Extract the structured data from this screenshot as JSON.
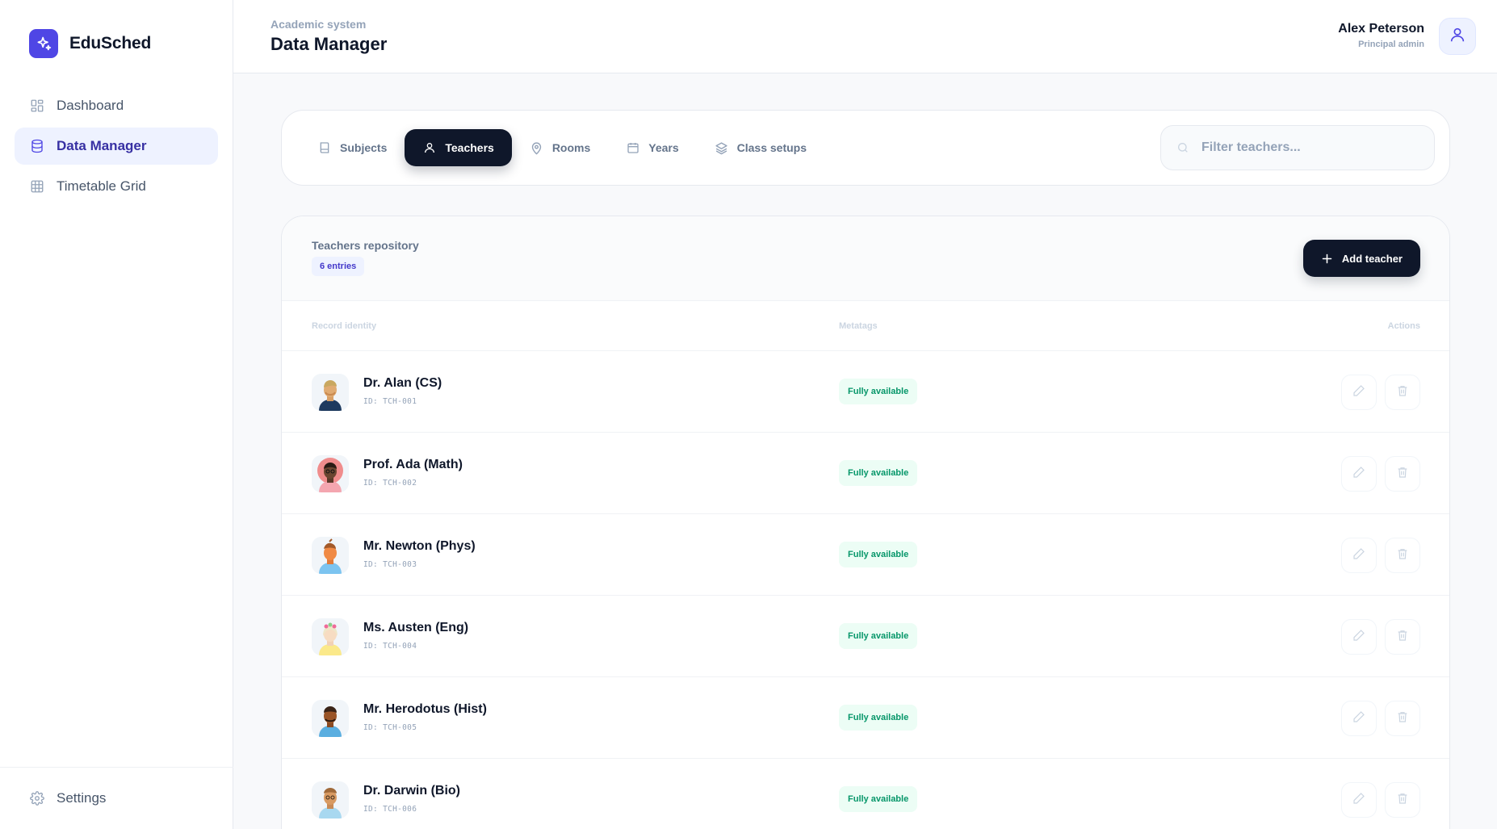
{
  "brand": {
    "name": "EduSched"
  },
  "nav": {
    "items": [
      {
        "label": "Dashboard",
        "icon": "dashboard-grid-icon",
        "active": false
      },
      {
        "label": "Data Manager",
        "icon": "database-icon",
        "active": true
      },
      {
        "label": "Timetable Grid",
        "icon": "table-grid-icon",
        "active": false
      }
    ],
    "settings_label": "Settings"
  },
  "header": {
    "eyebrow": "Academic system",
    "title": "Data Manager",
    "user_name": "Alex Peterson",
    "user_role": "Principal admin"
  },
  "tabs": [
    {
      "label": "Subjects",
      "icon": "book-icon",
      "active": false
    },
    {
      "label": "Teachers",
      "icon": "person-icon",
      "active": true
    },
    {
      "label": "Rooms",
      "icon": "map-pin-icon",
      "active": false
    },
    {
      "label": "Years",
      "icon": "calendar-icon",
      "active": false
    },
    {
      "label": "Class setups",
      "icon": "layers-icon",
      "active": false
    }
  ],
  "search": {
    "placeholder": "Filter teachers..."
  },
  "repository": {
    "title": "Teachers repository",
    "count_label": "6 entries",
    "add_label": "Add teacher",
    "columns": {
      "identity": "Record identity",
      "tags": "Metatags",
      "actions": "Actions"
    },
    "rows": [
      {
        "name": "Dr. Alan (CS)",
        "id": "ID: TCH-001",
        "status": "Fully available"
      },
      {
        "name": "Prof. Ada (Math)",
        "id": "ID: TCH-002",
        "status": "Fully available"
      },
      {
        "name": "Mr. Newton (Phys)",
        "id": "ID: TCH-003",
        "status": "Fully available"
      },
      {
        "name": "Ms. Austen (Eng)",
        "id": "ID: TCH-004",
        "status": "Fully available"
      },
      {
        "name": "Mr. Herodotus (Hist)",
        "id": "ID: TCH-005",
        "status": "Fully available"
      },
      {
        "name": "Dr. Darwin (Bio)",
        "id": "ID: TCH-006",
        "status": "Fully available"
      }
    ]
  },
  "colors": {
    "accent": "#4f46e5",
    "dark": "#0f172a",
    "success": "#059669"
  }
}
